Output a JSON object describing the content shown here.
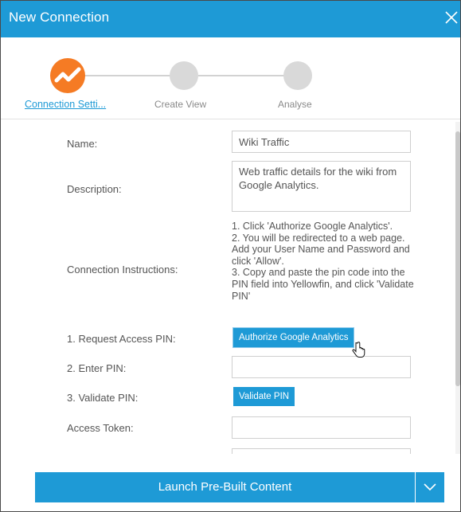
{
  "dialog": {
    "title": "New Connection",
    "accent_color": "#1e9ad6",
    "active_step_color": "#f57b24"
  },
  "steps": [
    {
      "label": "Connection Setti...",
      "state": "active"
    },
    {
      "label": "Create View",
      "state": "pending"
    },
    {
      "label": "Analyse",
      "state": "pending"
    }
  ],
  "form": {
    "name_label": "Name:",
    "name_value": "Wiki Traffic",
    "description_label": "Description:",
    "description_value": "Web traffic details for the wiki from Google Analytics.",
    "instructions_label": "Connection Instructions:",
    "instructions_text": "1. Click 'Authorize Google Analytics'.\n2. You will be redirected to a web page. Add your User Name and Password and click 'Allow'.\n3. Copy and paste the pin code into the PIN field into Yellowfin, and click 'Validate PIN'",
    "request_pin_label": "1. Request Access PIN:",
    "authorize_button": "Authorize Google Analytics",
    "enter_pin_label": "2. Enter PIN:",
    "enter_pin_value": "",
    "validate_pin_label": "3. Validate PIN:",
    "validate_button": "Validate PIN",
    "access_token_label": "Access Token:",
    "access_token_value": ""
  },
  "footer": {
    "launch_label": "Launch Pre-Built Content"
  },
  "icons": {
    "close": "close-icon",
    "step_active": "chart-line-icon",
    "dropdown": "chevron-down-icon",
    "cursor": "hand-pointer-icon"
  }
}
